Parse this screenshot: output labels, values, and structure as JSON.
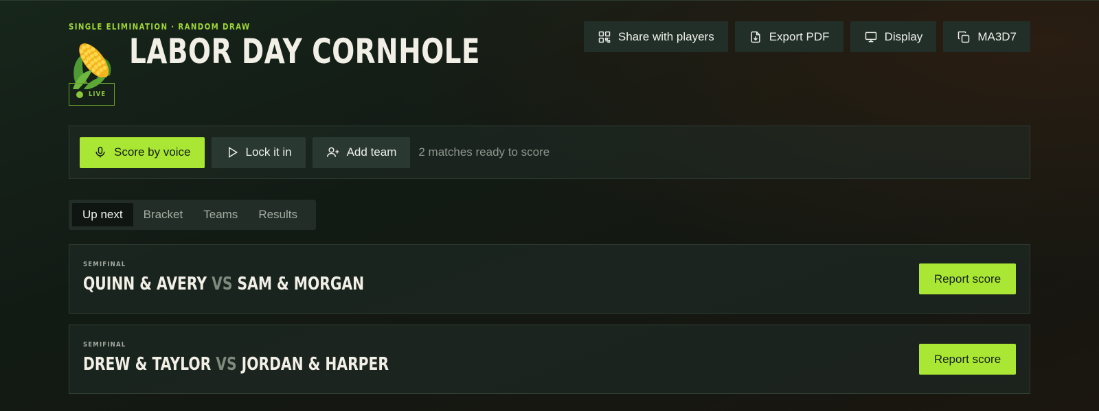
{
  "header": {
    "kicker": "SINGLE ELIMINATION · RANDOM DRAW",
    "title": "LABOR DAY CORNHOLE",
    "status": "LIVE",
    "actions": [
      {
        "label": "Share with players",
        "icon": "qr-code-icon"
      },
      {
        "label": "Export PDF",
        "icon": "file-download-icon"
      },
      {
        "label": "Display",
        "icon": "monitor-icon"
      },
      {
        "label": "MA3D7",
        "icon": "copy-icon"
      }
    ]
  },
  "toolbar": {
    "score_by_voice": "Score by voice",
    "lock_it_in": "Lock it in",
    "add_team": "Add team",
    "ready_text": "2 matches ready to score"
  },
  "tabs": [
    {
      "label": "Up next",
      "active": true
    },
    {
      "label": "Bracket",
      "active": false
    },
    {
      "label": "Teams",
      "active": false
    },
    {
      "label": "Results",
      "active": false
    }
  ],
  "matches": [
    {
      "round": "SEMIFINAL",
      "team_a": "QUINN & AVERY",
      "vs": "VS",
      "team_b": "SAM & MORGAN",
      "action": "Report score"
    },
    {
      "round": "SEMIFINAL",
      "team_a": "DREW & TAYLOR",
      "vs": "VS",
      "team_b": "JORDAN & HARPER",
      "action": "Report score"
    }
  ],
  "colors": {
    "accent": "#a9e734",
    "live": "#8cc63a",
    "kicker": "#9ed637"
  }
}
